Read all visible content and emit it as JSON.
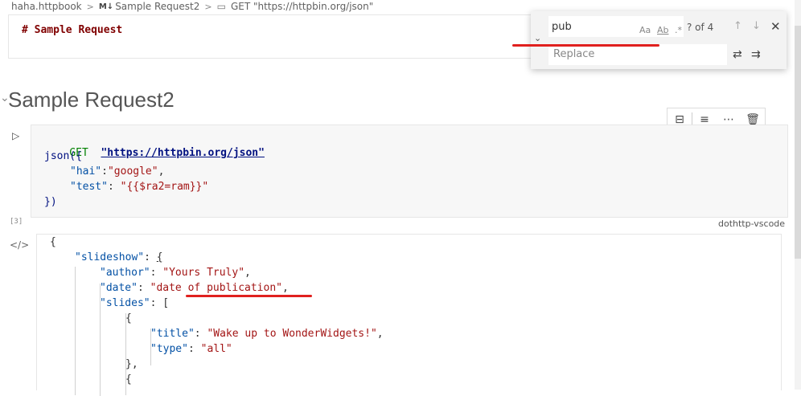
{
  "breadcrumb": {
    "file": "haha.httpbook",
    "badge": "M↓",
    "section": "Sample Request2",
    "request": "GET  \"https://httpbin.org/json\""
  },
  "markdown_cell": {
    "text": "# Sample Request"
  },
  "find_widget": {
    "search_value": "pub",
    "match_case": "Aa",
    "whole_word": "Ab",
    "regex": ".*",
    "count": "? of 4",
    "replace_placeholder": "Replace"
  },
  "heading": {
    "title": "Sample Request2"
  },
  "code_cell": {
    "method": "GET",
    "url": "\"https://httpbin.org/json\"",
    "func": "json({",
    "key1": "\"hai\"",
    "val1": "\"google\"",
    "key2": "\"test\"",
    "val2": "\"{{$ra2=ram}}\"",
    "close": "})",
    "exec_count": "[3]",
    "language": "dothttp-vscode"
  },
  "output": {
    "brace_open": "{",
    "slideshow_key": "\"slideshow\"",
    "author_key": "\"author\"",
    "author_val": "\"Yours Truly\"",
    "date_key": "\"date\"",
    "date_val": "\"date of publication\"",
    "slides_key": "\"slides\"",
    "title_key": "\"title\"",
    "title_val": "\"Wake up to WonderWidgets!\"",
    "type_key": "\"type\"",
    "type_val": "\"all\"",
    "obj_close": "},",
    "obj_open": "{"
  }
}
